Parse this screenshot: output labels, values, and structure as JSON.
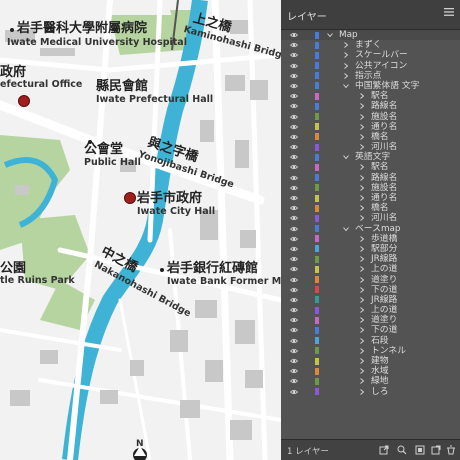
{
  "map": {
    "colors": {
      "park": "#b6d4a0",
      "water": "#3fb3d6",
      "building": "#c8c8c8",
      "road": "#ffffff",
      "rail": "#555555"
    },
    "labels": {
      "medical_jp": "岩手醫科大學附屬病院",
      "medical_en": "Iwate Medical University Hospital",
      "pref_office_jp": "政府",
      "pref_office_en": "efectural Office",
      "pref_hall_jp": "縣民會館",
      "pref_hall_en": "Iwate Prefectural Hall",
      "kaminohashi_jp": "上之橋",
      "kaminohashi_en": "Kaminohashi Bridge",
      "yonojibashi_jp": "與之字橋",
      "yonojibashi_en": "Yonojibashi Bridge",
      "public_hall_jp": "公會堂",
      "public_hall_en": "Public Hall",
      "city_hall_jp": "岩手市政府",
      "city_hall_en": "Iwate City Hall",
      "nakanohashi_jp": "中之橋",
      "nakanohashi_en": "Nakanohashi Bridge",
      "park_jp": "公園",
      "park_en": "tle Ruins Park",
      "bank_jp": "岩手銀行紅磚館",
      "bank_en": "Iwate Bank Former Main",
      "north": "N"
    }
  },
  "panel": {
    "tab_label": "レイヤー",
    "layers": [
      {
        "name": "Map",
        "indent": 0,
        "expanded": true,
        "color": "#4a7bd6",
        "top": true
      },
      {
        "name": "まずく",
        "indent": 1,
        "expanded": false,
        "color": "#4a7bd6"
      },
      {
        "name": "スケールバー",
        "indent": 1,
        "expanded": false,
        "color": "#4a7bd6"
      },
      {
        "name": "公共アイコン",
        "indent": 1,
        "expanded": false,
        "color": "#4a7bd6"
      },
      {
        "name": "指示点",
        "indent": 1,
        "expanded": false,
        "color": "#4a7bd6"
      },
      {
        "name": "中国繁体語 文字",
        "indent": 1,
        "expanded": true,
        "color": "#4a7bd6"
      },
      {
        "name": "駅名",
        "indent": 2,
        "expanded": false,
        "color": "#c46ac4"
      },
      {
        "name": "路線名",
        "indent": 2,
        "expanded": false,
        "color": "#4a7bd6"
      },
      {
        "name": "施設名",
        "indent": 2,
        "expanded": false,
        "color": "#6a9a4a"
      },
      {
        "name": "通り名",
        "indent": 2,
        "expanded": false,
        "color": "#c4c44a"
      },
      {
        "name": "橋名",
        "indent": 2,
        "expanded": false,
        "color": "#d68a3a"
      },
      {
        "name": "河川名",
        "indent": 2,
        "expanded": false,
        "color": "#8a5ad6"
      },
      {
        "name": "英語文字",
        "indent": 1,
        "expanded": true,
        "color": "#4a7bd6"
      },
      {
        "name": "駅名",
        "indent": 2,
        "expanded": false,
        "color": "#c46ac4"
      },
      {
        "name": "路線名",
        "indent": 2,
        "expanded": false,
        "color": "#4a7bd6"
      },
      {
        "name": "施設名",
        "indent": 2,
        "expanded": false,
        "color": "#6a9a4a"
      },
      {
        "name": "通り名",
        "indent": 2,
        "expanded": false,
        "color": "#c4c44a"
      },
      {
        "name": "橋名",
        "indent": 2,
        "expanded": false,
        "color": "#d68a3a"
      },
      {
        "name": "河川名",
        "indent": 2,
        "expanded": false,
        "color": "#8a5ad6"
      },
      {
        "name": "ベースmap",
        "indent": 1,
        "expanded": true,
        "color": "#4a7bd6"
      },
      {
        "name": "歩道橋",
        "indent": 2,
        "expanded": false,
        "color": "#c46ac4"
      },
      {
        "name": "駅部分",
        "indent": 2,
        "expanded": false,
        "color": "#4aa6d6"
      },
      {
        "name": "JR線路",
        "indent": 2,
        "expanded": false,
        "color": "#6a9a4a"
      },
      {
        "name": "上の道",
        "indent": 2,
        "expanded": false,
        "color": "#c4c44a"
      },
      {
        "name": "道塗り",
        "indent": 2,
        "expanded": false,
        "color": "#d68a3a"
      },
      {
        "name": "下の道",
        "indent": 2,
        "expanded": false,
        "color": "#d64a4a"
      },
      {
        "name": "JR線路",
        "indent": 2,
        "expanded": false,
        "color": "#3a9a9a"
      },
      {
        "name": "上の道",
        "indent": 2,
        "expanded": false,
        "color": "#8a5ad6"
      },
      {
        "name": "道塗り",
        "indent": 2,
        "expanded": false,
        "color": "#c46ac4"
      },
      {
        "name": "下の道",
        "indent": 2,
        "expanded": false,
        "color": "#4a7bd6"
      },
      {
        "name": "石段",
        "indent": 2,
        "expanded": false,
        "color": "#4aa6d6"
      },
      {
        "name": "トンネル",
        "indent": 2,
        "expanded": false,
        "color": "#6a9a4a"
      },
      {
        "name": "建物",
        "indent": 2,
        "expanded": false,
        "color": "#c4c44a"
      },
      {
        "name": "水域",
        "indent": 2,
        "expanded": false,
        "color": "#d68a3a"
      },
      {
        "name": "緑地",
        "indent": 2,
        "expanded": false,
        "color": "#6a9a4a"
      },
      {
        "name": "しろ",
        "indent": 2,
        "expanded": false,
        "color": "#8a5ad6"
      }
    ],
    "footer_label": "1 レイヤー"
  }
}
